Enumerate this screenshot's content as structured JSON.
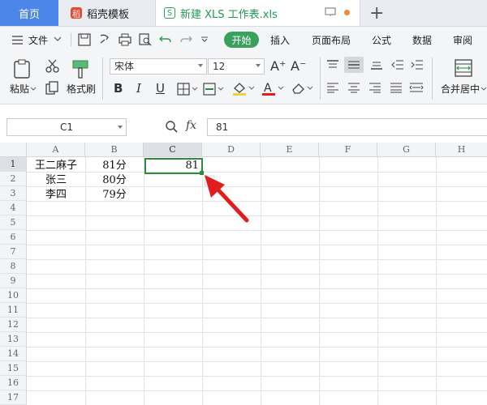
{
  "tabs": [
    {
      "label": "首页"
    },
    {
      "label": "稻壳模板",
      "logo": "稻"
    },
    {
      "label": "新建 XLS 工作表.xls",
      "logo": "S"
    }
  ],
  "menu": {
    "file_label": "文件",
    "start_label": "开始",
    "items": [
      "插入",
      "页面布局",
      "公式",
      "数据",
      "审阅"
    ]
  },
  "ribbon": {
    "paste_label": "粘贴",
    "format_painter_label": "格式刷",
    "font_name": "宋体",
    "font_size": "12",
    "merge_label": "合并居中",
    "bold": "B",
    "italic": "I",
    "underline": "U",
    "font_grow": "A⁺",
    "font_shrink": "A⁻"
  },
  "formula_bar": {
    "name_box": "C1",
    "fx_label": "fx",
    "value": "81"
  },
  "sheet": {
    "columns": [
      "A",
      "B",
      "C",
      "D",
      "E",
      "F",
      "G",
      "H"
    ],
    "rows": [
      "1",
      "2",
      "3",
      "4",
      "5",
      "6",
      "7",
      "8",
      "9",
      "10",
      "11",
      "12",
      "13",
      "14",
      "15",
      "16",
      "17"
    ],
    "cells": {
      "A1": "王二麻子",
      "B1": "81分",
      "C1": "81",
      "A2": "张三",
      "B2": "80分",
      "A3": "李四",
      "B3": "79分"
    },
    "active_cell": "C1"
  },
  "colors": {
    "accent_green": "#3aa05d",
    "home_tab_blue": "#4c86e8",
    "selection_green": "#2e8b3e",
    "annotation_red": "#e21d1d"
  }
}
